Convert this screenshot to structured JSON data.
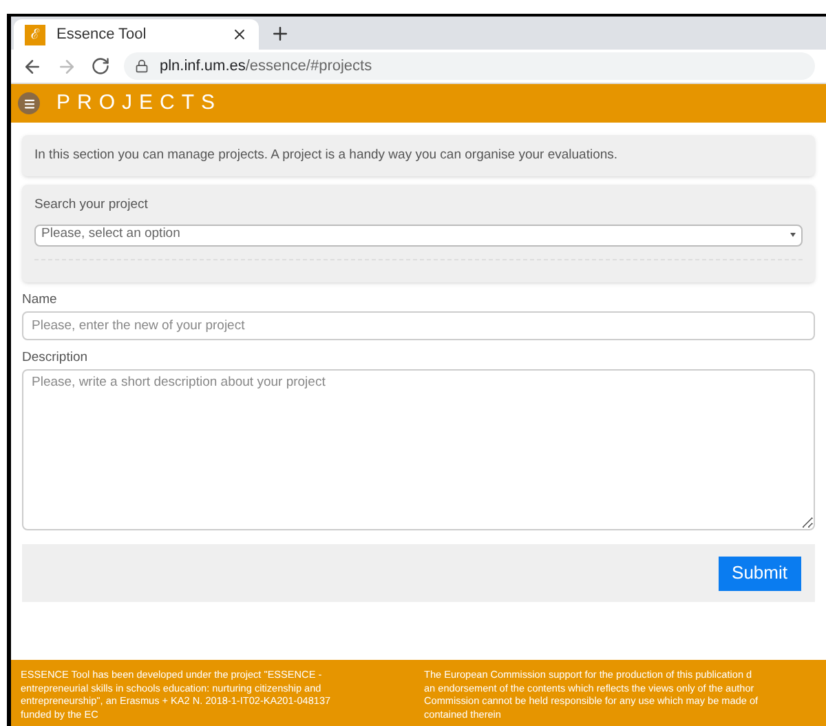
{
  "browser": {
    "tab_title": "Essence Tool",
    "tab_logo": "ℰ",
    "url_host": "pln.inf.um.es",
    "url_path": "/essence/#projects"
  },
  "header": {
    "title": "PROJECTS"
  },
  "intro": "In this section you can manage projects. A project is a handy way you can organise your evaluations.",
  "search": {
    "label": "Search your project",
    "placeholder": "Please, select an option"
  },
  "name_field": {
    "label": "Name",
    "placeholder": "Please, enter the new of your project"
  },
  "description_field": {
    "label": "Description",
    "placeholder": "Please, write a short description about your project"
  },
  "submit": "Submit",
  "footer": [
    {
      "lines": [
        "ESSENCE Tool has been developed under the project \"ESSENCE -",
        "entrepreneurial skills in schools education: nurturing citizenship and",
        "entrepreneurship\", an Erasmus + KA2 N. 2018-1-IT02-KA201-048137",
        "funded by the EC"
      ]
    },
    {
      "lines": [
        "The European Commission support for the production of this publication d",
        "an endorsement of the contents which reflects the views only of the author",
        "Commission cannot be held responsible for any use which may be made of",
        "contained therein"
      ]
    }
  ]
}
